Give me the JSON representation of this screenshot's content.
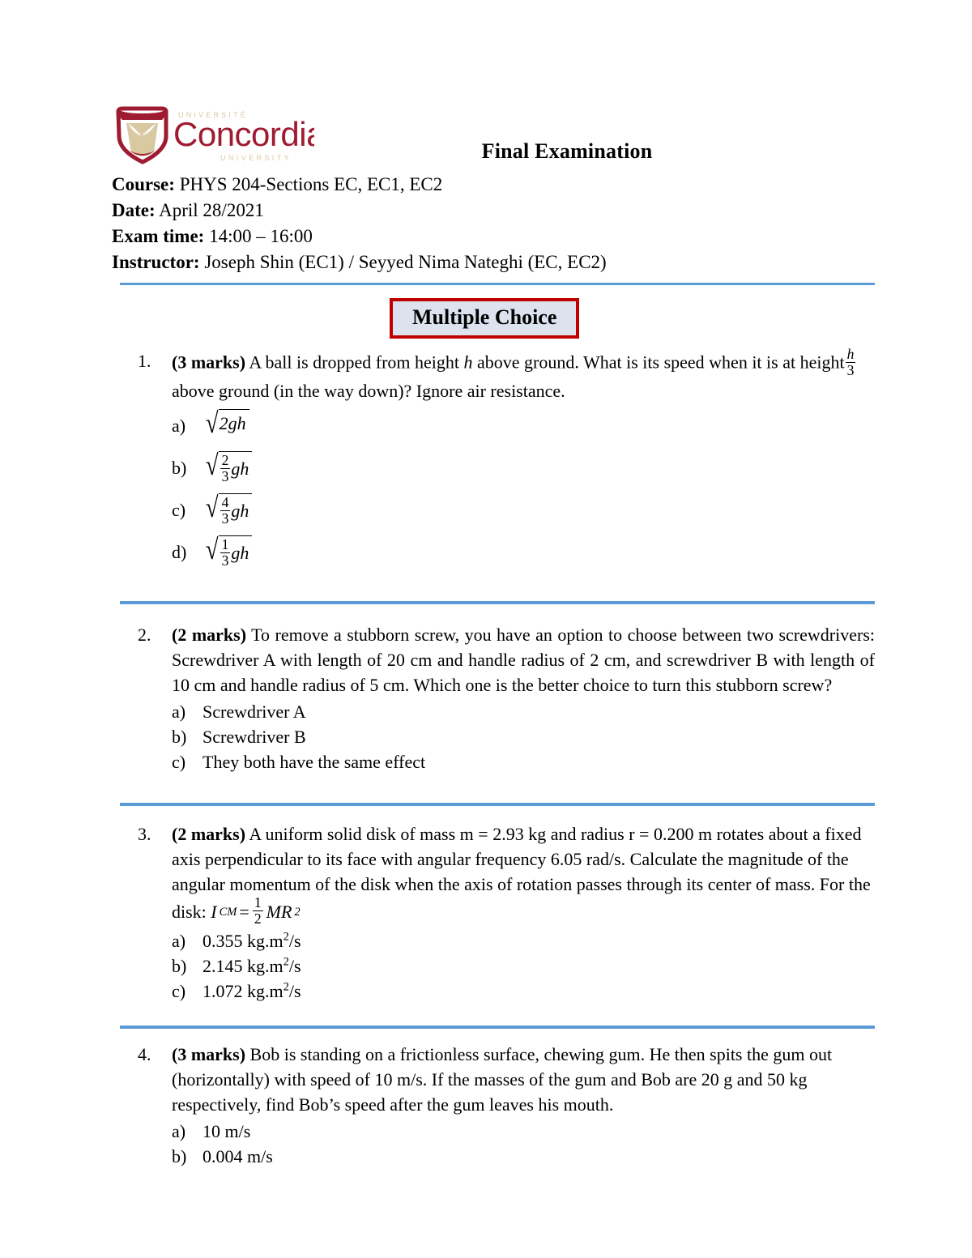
{
  "document": {
    "institution": {
      "name": "Concordia",
      "tagline_top": "U N I V E R S I T É",
      "tagline_bottom": "U N I V E R S I T Y",
      "crimson": "#9E1B32",
      "gold": "#D8C9A3"
    },
    "title": "Final Examination",
    "meta": [
      {
        "label": "Course:",
        "value": "PHYS 204-Sections EC, EC1, EC2"
      },
      {
        "label": "Date:",
        "value": "April 28/2021"
      },
      {
        "label": "Exam time:",
        "value": "14:00 – 16:00"
      },
      {
        "label": "Instructor:",
        "value": "Joseph Shin (EC1) / Seyyed Nima Nateghi (EC, EC2)"
      }
    ],
    "section_title": "Multiple Choice",
    "rule_color": "#5B9BD5",
    "box_border_color": "#C00000",
    "box_fill_color": "#DCE3EF"
  },
  "questions": [
    {
      "number": "1.",
      "marks": "(3 marks)",
      "text_part1": " A ball is dropped from height ",
      "var1": "h",
      "text_part2": " above ground.  What is its speed when it is at height",
      "fraction": {
        "num": "h",
        "den": "3"
      },
      "text_part3": " above ground (in the way down)? Ignore air resistance.",
      "options": [
        {
          "letter": "a)",
          "coef_num": "",
          "coef_den": "",
          "radicand_lead": "2",
          "radicand_tail": "gh"
        },
        {
          "letter": "b)",
          "coef_num": "2",
          "coef_den": "3",
          "radicand_lead": "",
          "radicand_tail": "gh"
        },
        {
          "letter": "c)",
          "coef_num": "4",
          "coef_den": "3",
          "radicand_lead": "",
          "radicand_tail": "gh"
        },
        {
          "letter": "d)",
          "coef_num": "1",
          "coef_den": "3",
          "radicand_lead": "",
          "radicand_tail": "gh"
        }
      ]
    },
    {
      "number": "2.",
      "marks": "(2 marks)",
      "text": " To remove a stubborn screw, you have an option to choose between two screwdrivers: Screwdriver A with length of 20 cm and handle radius of 2 cm, and screwdriver B with length of 10 cm and handle radius of 5 cm.  Which one is the better choice to turn this stubborn screw?",
      "options": [
        {
          "letter": "a)",
          "text": "Screwdriver A"
        },
        {
          "letter": "b)",
          "text": "Screwdriver B"
        },
        {
          "letter": "c)",
          "text": "They both have the same effect"
        }
      ]
    },
    {
      "number": "3.",
      "marks": "(2 marks)",
      "text": " A uniform solid disk of mass m = 2.93 kg and radius r = 0.200 m rotates about a fixed axis perpendicular to its face with angular frequency 6.05 rad/s. Calculate the magnitude of the angular momentum of the disk when the axis of rotation passes through its center of mass. For the disk:",
      "formula": {
        "symbol": "I",
        "subscript": "CM",
        "equals": "=",
        "num": "1",
        "den": "2",
        "body": "MR",
        "exponent": "2"
      },
      "options": [
        {
          "letter": "a)",
          "value": "0.355",
          "unit_lead": " kg.m",
          "unit_exp": "2",
          "unit_tail": "/s"
        },
        {
          "letter": "b)",
          "value": "2.145",
          "unit_lead": " kg.m",
          "unit_exp": "2",
          "unit_tail": "/s"
        },
        {
          "letter": "c)",
          "value": "1.072",
          "unit_lead": " kg.m",
          "unit_exp": "2",
          "unit_tail": "/s"
        }
      ]
    },
    {
      "number": "4.",
      "marks": "(3 marks)",
      "text": " Bob is standing on a frictionless surface, chewing gum. He then spits the gum out (horizontally) with speed of 10 m/s. If the masses of the gum and Bob are 20 g and 50 kg respectively, find Bob’s speed after the gum leaves his mouth.",
      "options": [
        {
          "letter": "a)",
          "text": "10 m/s"
        },
        {
          "letter": "b)",
          "text": "0.004 m/s"
        }
      ]
    }
  ]
}
